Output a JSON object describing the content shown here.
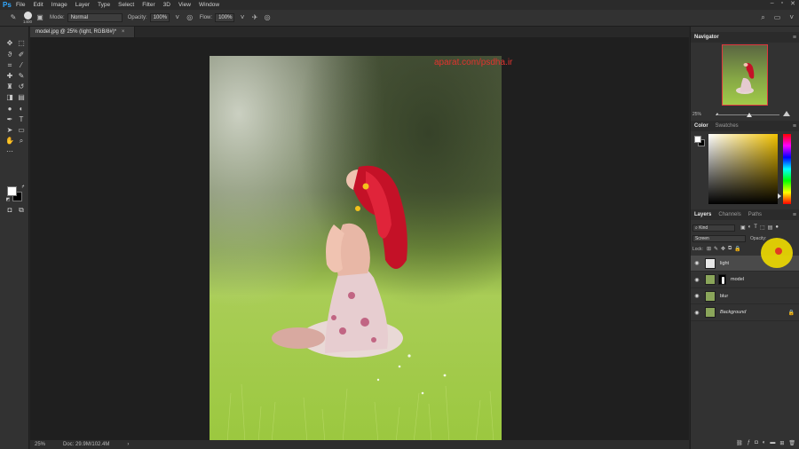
{
  "app": {
    "logo": "Ps",
    "menu": [
      "File",
      "Edit",
      "Image",
      "Layer",
      "Type",
      "Select",
      "Filter",
      "3D",
      "View",
      "Window"
    ],
    "window_controls": [
      "–",
      "▫",
      "✕"
    ]
  },
  "options_bar": {
    "brush_size": "1400",
    "mode_label": "Mode:",
    "mode_value": "Normal",
    "opacity_label": "Opacity:",
    "opacity_value": "100%",
    "flow_label": "Flow:",
    "flow_value": "100%"
  },
  "document": {
    "tab_title": "model.jpg @ 25% (light, RGB/8#)",
    "tab_modified": "*",
    "tab_close": "×",
    "watermark": "aparat.com/psdha.ir",
    "zoom": "25%",
    "doc_size": "Doc: 29.9M/102.4M",
    "status_arrow": "›"
  },
  "panels": {
    "navigator": {
      "title": "Navigator",
      "zoom": "25%"
    },
    "color": {
      "tabs": [
        "Color",
        "Swatches"
      ]
    },
    "layers": {
      "tabs": [
        "Layers",
        "Channels",
        "Paths"
      ],
      "kind_label": "Kind",
      "blend_mode": "Screen",
      "opacity_label": "Opacity:",
      "lock_label": "Lock:",
      "items": [
        {
          "name": "light",
          "selected": true,
          "italic": false,
          "has_mask": false,
          "locked": false,
          "thumb_color": "#e8e8e8"
        },
        {
          "name": "model",
          "selected": false,
          "italic": false,
          "has_mask": true,
          "locked": false,
          "thumb_color": "#8aa55a"
        },
        {
          "name": "blur",
          "selected": false,
          "italic": false,
          "has_mask": false,
          "locked": false,
          "thumb_color": "#8aa55a"
        },
        {
          "name": "Background",
          "selected": false,
          "italic": true,
          "has_mask": false,
          "locked": true,
          "thumb_color": "#8aa55a"
        }
      ]
    }
  },
  "colors": {
    "accent": "#31a8ff",
    "watermark": "#e2332e",
    "hair": "#c41127",
    "grass": "#8fbf3a"
  }
}
